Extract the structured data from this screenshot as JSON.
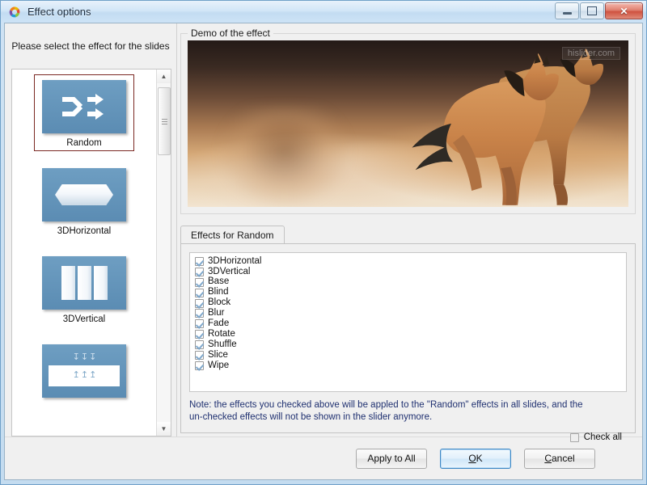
{
  "window": {
    "title": "Effect options",
    "icon": "app-ring-icon",
    "controls": {
      "minimize": "minimize",
      "restore": "restore",
      "close": "close"
    }
  },
  "left_panel": {
    "header": "Please select the effect for the slides",
    "thumbnails": [
      {
        "label": "Random",
        "icon": "shuffle-arrows-icon",
        "selected": true
      },
      {
        "label": "3DHorizontal",
        "icon": "hexagon-slab-icon",
        "selected": false
      },
      {
        "label": "3DVertical",
        "icon": "three-panels-icon",
        "selected": false
      },
      {
        "label": "",
        "icon": "blind-arrows-icon",
        "selected": false
      }
    ],
    "scrollbar": {
      "up": "▲",
      "down": "▼"
    }
  },
  "demo": {
    "group_title": "Demo of the effect",
    "watermark": "hislider.com"
  },
  "effects": {
    "tab_label": "Effects for Random",
    "items": [
      {
        "label": "3DHorizontal",
        "checked": true
      },
      {
        "label": "3DVertical",
        "checked": true
      },
      {
        "label": "Base",
        "checked": true
      },
      {
        "label": "Blind",
        "checked": true
      },
      {
        "label": "Block",
        "checked": true
      },
      {
        "label": "Blur",
        "checked": true
      },
      {
        "label": "Fade",
        "checked": true
      },
      {
        "label": "Rotate",
        "checked": true
      },
      {
        "label": "Shuffle",
        "checked": true
      },
      {
        "label": "Slice",
        "checked": true
      },
      {
        "label": "Wipe",
        "checked": true
      }
    ],
    "note_line1": "Note: the effects you checked above will be appled to the \"Random\"  effects in all slides, and the",
    "note_line2": "un-checked effects will not be shown in the slider anymore.",
    "check_all_label": "Check all",
    "check_all_checked": false
  },
  "footer": {
    "apply_to_all": "Apply to All",
    "ok": "OK",
    "cancel": "Cancel"
  },
  "colors": {
    "selection_border": "#7a2822",
    "note_text": "#1f3070",
    "thumb_blue": "#5b8cb3",
    "default_button_border": "#3d87c4"
  }
}
